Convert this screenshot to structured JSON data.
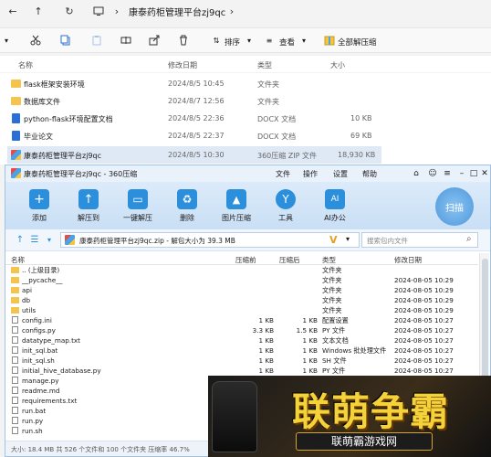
{
  "explorer": {
    "address": "康泰药柜管理平台zj9qc",
    "toolbar": {
      "sort_label": "排序",
      "view_label": "查看",
      "extract_all_label": "全部解压缩"
    },
    "columns": {
      "name": "名称",
      "modified": "修改日期",
      "type": "类型",
      "size": "大小"
    },
    "files": [
      {
        "name": "flask框架安装环境",
        "date": "2024/8/5 10:45",
        "type": "文件夹",
        "size": "",
        "kind": "folder"
      },
      {
        "name": "数据库文件",
        "date": "2024/8/7 12:56",
        "type": "文件夹",
        "size": "",
        "kind": "folder"
      },
      {
        "name": "python-flask环境配置文档",
        "date": "2024/8/5 22:36",
        "type": "DOCX 文档",
        "size": "10 KB",
        "kind": "docx"
      },
      {
        "name": "毕业论文",
        "date": "2024/8/5 22:37",
        "type": "DOCX 文档",
        "size": "69 KB",
        "kind": "docx"
      },
      {
        "name": "康泰药柜管理平台zj9qc",
        "date": "2024/8/5 10:30",
        "type": "360压缩 ZIP 文件",
        "size": "18,930 KB",
        "kind": "zip"
      }
    ]
  },
  "zipwin": {
    "title": "康泰药柜管理平台zj9qc - 360压缩",
    "menu": [
      "文件",
      "操作",
      "设置",
      "帮助"
    ],
    "tools": [
      {
        "label": "添加",
        "color": "#2c8fdc"
      },
      {
        "label": "解压到",
        "color": "#2c8fdc"
      },
      {
        "label": "一键解压",
        "color": "#2c8fdc"
      },
      {
        "label": "删除",
        "color": "#2c8fdc"
      },
      {
        "label": "图片压缩",
        "color": "#2c8fdc"
      },
      {
        "label": "工具",
        "color": "#2c8fdc"
      },
      {
        "label": "AI办公",
        "color": "#2c8fdc"
      }
    ],
    "scan_label": "扫描",
    "path_text": "康泰药柜管理平台zj9qc.zip - 解包大小为 39.3 MB",
    "search_placeholder": "搜索包内文件",
    "columns": {
      "name": "名称",
      "compressed": "压缩前",
      "packed": "压缩后",
      "type": "类型",
      "modified": "修改日期"
    },
    "rows": [
      {
        "name": ".. (上级目录)",
        "c": "",
        "p": "",
        "type": "文件夹",
        "date": "",
        "kind": "folder"
      },
      {
        "name": "__pycache__",
        "c": "",
        "p": "",
        "type": "文件夹",
        "date": "2024-08-05 10:29",
        "kind": "folder"
      },
      {
        "name": "api",
        "c": "",
        "p": "",
        "type": "文件夹",
        "date": "2024-08-05 10:29",
        "kind": "folder"
      },
      {
        "name": "db",
        "c": "",
        "p": "",
        "type": "文件夹",
        "date": "2024-08-05 10:29",
        "kind": "folder"
      },
      {
        "name": "utils",
        "c": "",
        "p": "",
        "type": "文件夹",
        "date": "2024-08-05 10:29",
        "kind": "folder"
      },
      {
        "name": "config.ini",
        "c": "1 KB",
        "p": "1 KB",
        "type": "配置设置",
        "date": "2024-08-05 10:27",
        "kind": "doc"
      },
      {
        "name": "configs.py",
        "c": "3.3 KB",
        "p": "1.5 KB",
        "type": "PY 文件",
        "date": "2024-08-05 10:27",
        "kind": "doc"
      },
      {
        "name": "datatype_map.txt",
        "c": "1 KB",
        "p": "1 KB",
        "type": "文本文档",
        "date": "2024-08-05 10:27",
        "kind": "doc"
      },
      {
        "name": "init_sql.bat",
        "c": "1 KB",
        "p": "1 KB",
        "type": "Windows 批处理文件",
        "date": "2024-08-05 10:27",
        "kind": "doc"
      },
      {
        "name": "init_sql.sh",
        "c": "1 KB",
        "p": "1 KB",
        "type": "SH 文件",
        "date": "2024-08-05 10:27",
        "kind": "doc"
      },
      {
        "name": "initial_hive_database.py",
        "c": "1 KB",
        "p": "1 KB",
        "type": "PY 文件",
        "date": "2024-08-05 10:27",
        "kind": "doc"
      },
      {
        "name": "manage.py",
        "c": "",
        "p": "",
        "type": "",
        "date": "",
        "kind": "doc"
      },
      {
        "name": "readme.md",
        "c": "",
        "p": "",
        "type": "",
        "date": "",
        "kind": "doc"
      },
      {
        "name": "requirements.txt",
        "c": "",
        "p": "",
        "type": "",
        "date": "",
        "kind": "doc"
      },
      {
        "name": "run.bat",
        "c": "",
        "p": "",
        "type": "",
        "date": "",
        "kind": "doc"
      },
      {
        "name": "run.py",
        "c": "",
        "p": "",
        "type": "",
        "date": "",
        "kind": "doc"
      },
      {
        "name": "run.sh",
        "c": "",
        "p": "",
        "type": "",
        "date": "",
        "kind": "doc"
      }
    ],
    "status": "大小: 18.4 MB 共 526 个文件和 100 个文件夹 压缩率 46.7%"
  },
  "ad": {
    "title": "联萌争霸",
    "subtitle": "联萌霸游戏网"
  }
}
